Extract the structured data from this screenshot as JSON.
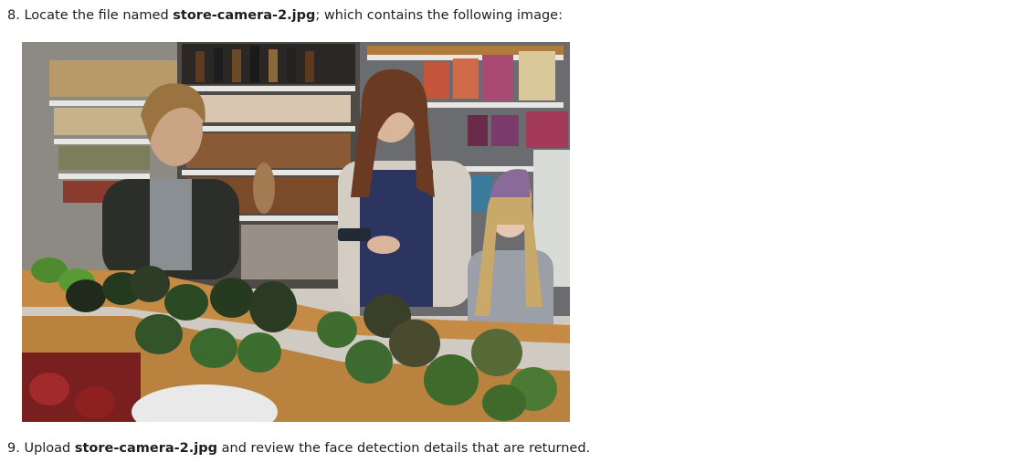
{
  "steps": [
    {
      "number": "8.",
      "before": " Locate the file named ",
      "filename": "store-camera-2.jpg",
      "after": "; which contains the following image:"
    },
    {
      "number": "9.",
      "before": " Upload ",
      "filename": "store-camera-2.jpg",
      "after": " and review the face detection details that are returned."
    }
  ],
  "image": {
    "description_icon": "store-photo",
    "colors": {
      "floor": "#b9833f",
      "shelves": "#5b5f66",
      "avocado": "#243a1f",
      "crate": "#c58b45"
    }
  }
}
